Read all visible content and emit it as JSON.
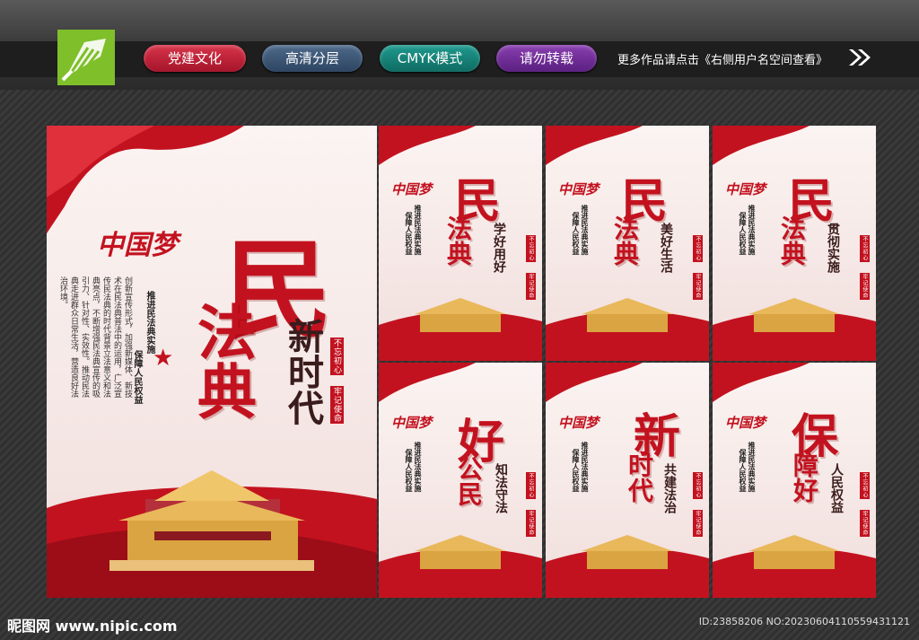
{
  "header": {
    "tags": [
      "党建文化",
      "高清分层",
      "CMYK模式",
      "请勿转载"
    ],
    "more_text": "更多作品请点击《右侧用户名空间查看》",
    "logo_icon": "pen-nib-icon",
    "arrow_icon": "double-chevron-right-icon"
  },
  "main_poster": {
    "brand": "中国梦",
    "title_char1": "民",
    "title_chars23": "法典",
    "subtitle": "新时代",
    "stamp1": "不忘初心",
    "stamp2": "牢记使命",
    "lead1": "推进民法典实施",
    "lead2": "保障人民权益",
    "body": "创新宣传形式，加强新媒体、新技术在民法典普法中的运用，广泛宣传民法典的时代背景立法意义和法典亮点，不断增强民法典宣传的吸引力、针对性、实效性。推动民法典走进群众日常生活，营造良好法治环境。"
  },
  "small_posters": [
    {
      "brand": "中国梦",
      "main": "民",
      "sub": "法典",
      "slogan": "学好用好",
      "lead1": "推进民法典实施",
      "lead2": "保障人民权益",
      "stamp1": "不忘初心",
      "stamp2": "牢记使命"
    },
    {
      "brand": "中国梦",
      "main": "民",
      "sub": "法典",
      "slogan": "美好生活",
      "lead1": "推进民法典实施",
      "lead2": "保障人民权益",
      "stamp1": "不忘初心",
      "stamp2": "牢记使命"
    },
    {
      "brand": "中国梦",
      "main": "民",
      "sub": "法典",
      "slogan": "贯彻实施",
      "lead1": "推进民法典实施",
      "lead2": "保障人民权益",
      "stamp1": "不忘初心",
      "stamp2": "牢记使命"
    },
    {
      "brand": "中国梦",
      "main": "好",
      "sub": "公民",
      "slogan": "知法守法",
      "lead1": "推进民法典实施",
      "lead2": "保障人民权益",
      "stamp1": "不忘初心",
      "stamp2": "牢记使命"
    },
    {
      "brand": "中国梦",
      "main": "新",
      "sub": "时代",
      "slogan": "共建法治",
      "lead1": "推进民法典实施",
      "lead2": "保障人民权益",
      "stamp1": "不忘初心",
      "stamp2": "牢记使命"
    },
    {
      "brand": "中国梦",
      "main": "保",
      "sub": "障好",
      "slogan": "人民权益",
      "lead1": "推进民法典实施",
      "lead2": "保障人民权益",
      "stamp1": "不忘初心",
      "stamp2": "牢记使命"
    }
  ],
  "footer": {
    "site": "昵图网 www.nipic.com",
    "id": "ID:23858206 NO:20230604110559431121"
  },
  "colors": {
    "accent_red": "#c3121f",
    "gold": "#d9a441",
    "logo_green": "#7fbf2a"
  }
}
